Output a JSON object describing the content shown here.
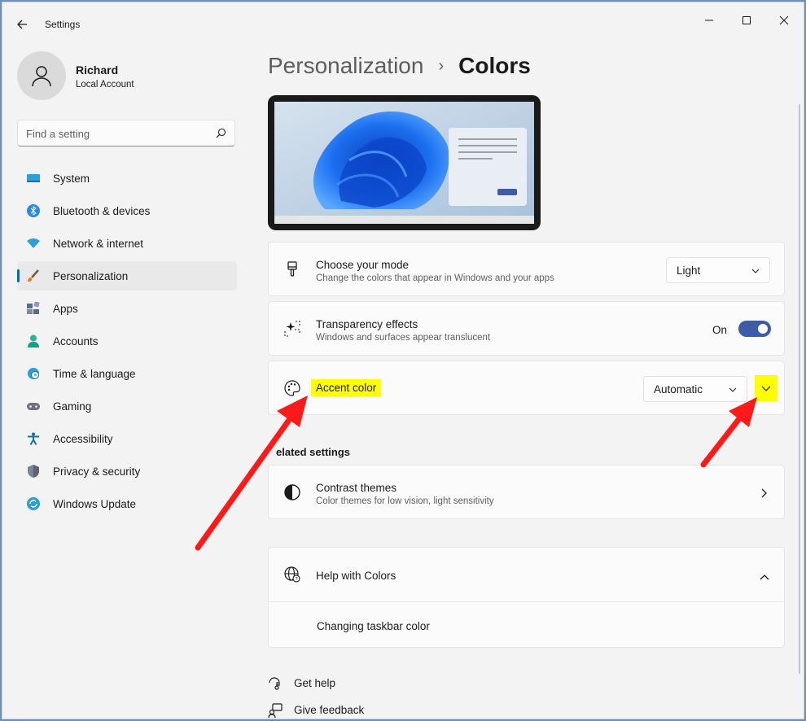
{
  "window": {
    "app_title": "Settings"
  },
  "user": {
    "name": "Richard",
    "account_type": "Local Account"
  },
  "search": {
    "placeholder": "Find a setting"
  },
  "sidebar": {
    "items": [
      {
        "label": "System",
        "icon": "system-icon",
        "active": false
      },
      {
        "label": "Bluetooth & devices",
        "icon": "bluetooth-icon",
        "active": false
      },
      {
        "label": "Network & internet",
        "icon": "wifi-icon",
        "active": false
      },
      {
        "label": "Personalization",
        "icon": "brush-icon",
        "active": true
      },
      {
        "label": "Apps",
        "icon": "apps-icon",
        "active": false
      },
      {
        "label": "Accounts",
        "icon": "person-icon",
        "active": false
      },
      {
        "label": "Time & language",
        "icon": "globe-clock-icon",
        "active": false
      },
      {
        "label": "Gaming",
        "icon": "gamepad-icon",
        "active": false
      },
      {
        "label": "Accessibility",
        "icon": "accessibility-icon",
        "active": false
      },
      {
        "label": "Privacy & security",
        "icon": "shield-icon",
        "active": false
      },
      {
        "label": "Windows Update",
        "icon": "update-icon",
        "active": false
      }
    ]
  },
  "breadcrumb": {
    "parent": "Personalization",
    "separator": "›",
    "current": "Colors"
  },
  "settings": {
    "mode": {
      "title": "Choose your mode",
      "subtitle": "Change the colors that appear in Windows and your apps",
      "value": "Light"
    },
    "transparency": {
      "title": "Transparency effects",
      "subtitle": "Windows and surfaces appear translucent",
      "state_label": "On",
      "enabled": true
    },
    "accent": {
      "title": "Accent color",
      "value": "Automatic"
    }
  },
  "related": {
    "heading": "elated settings",
    "contrast": {
      "title": "Contrast themes",
      "subtitle": "Color themes for low vision, light sensitivity"
    }
  },
  "help": {
    "title": "Help with Colors",
    "link": "Changing taskbar color"
  },
  "footer": {
    "get_help": "Get help",
    "give_feedback": "Give feedback"
  },
  "colors": {
    "accent": "#0067c0",
    "toggle": "#3e5ba8",
    "highlight": "#ffff00",
    "arrow": "#ff1a1a"
  }
}
